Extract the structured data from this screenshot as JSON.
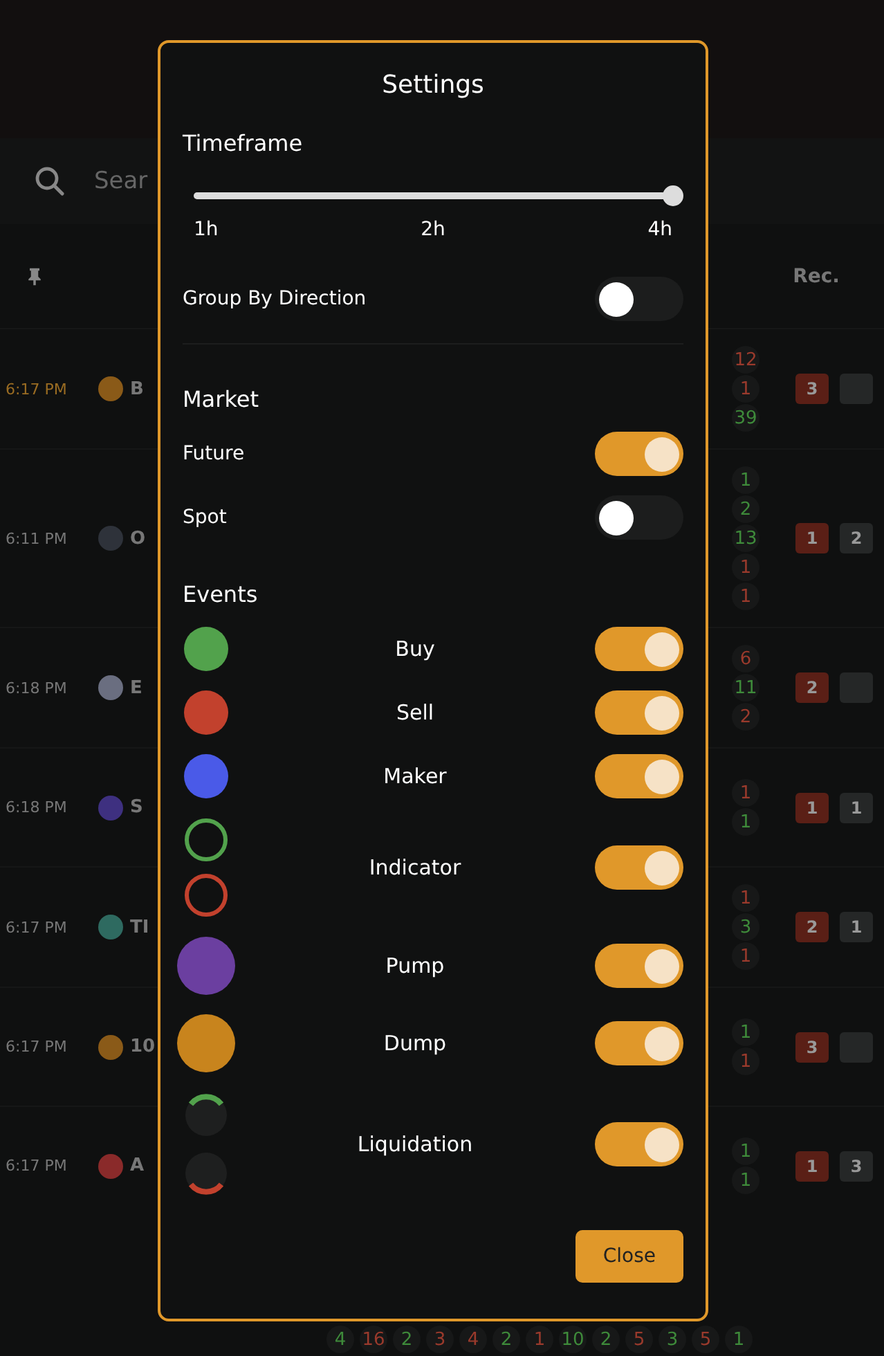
{
  "background": {
    "search": {
      "placeholder": "Sear"
    },
    "rec_header": "Rec.",
    "rows": [
      {
        "time": "6:17 PM",
        "ticker": "B",
        "highlighted": true,
        "color": "#8a5a18",
        "counts": [
          {
            "value": "12",
            "color": "#9a3a2c"
          },
          {
            "value": "1",
            "color": "#9a3a2c"
          },
          {
            "value": "39",
            "color": "#3e8a3a"
          }
        ],
        "rec_sell": "3"
      },
      {
        "time": "6:11 PM",
        "ticker": "O",
        "highlighted": false,
        "color": "#2e323a",
        "counts": [
          {
            "value": "1",
            "color": "#3e8a3a"
          },
          {
            "value": "2",
            "color": "#3e8a3a"
          },
          {
            "value": "13",
            "color": "#3e8a3a"
          },
          {
            "value": "1",
            "color": "#9a3a2c"
          },
          {
            "value": "1",
            "color": "#9a3a2c"
          }
        ],
        "rec_sell": "1",
        "rec_buy": "2"
      },
      {
        "time": "6:18 PM",
        "ticker": "E",
        "highlighted": false,
        "color": "#6a6e80",
        "counts": [
          {
            "value": "6",
            "color": "#9a3a2c"
          },
          {
            "value": "11",
            "color": "#3e8a3a"
          },
          {
            "value": "2",
            "color": "#9a3a2c"
          }
        ],
        "rec_sell": "2"
      },
      {
        "time": "6:18 PM",
        "ticker": "S",
        "highlighted": false,
        "color": "#3e3080",
        "counts": [
          {
            "value": "1",
            "color": "#9a3a2c"
          },
          {
            "value": "1",
            "color": "#3e8a3a"
          }
        ],
        "rec_sell": "1",
        "rec_buy": "1"
      },
      {
        "time": "6:17 PM",
        "ticker": "TI",
        "highlighted": false,
        "color": "#2e6a60",
        "counts": [
          {
            "value": "1",
            "color": "#9a3a2c"
          },
          {
            "value": "3",
            "color": "#3e8a3a"
          },
          {
            "value": "1",
            "color": "#9a3a2c"
          }
        ],
        "rec_sell": "2",
        "rec_buy": "1"
      },
      {
        "time": "6:17 PM",
        "ticker": "10",
        "highlighted": false,
        "color": "#8a5a18",
        "counts": [
          {
            "value": "1",
            "color": "#3e8a3a"
          },
          {
            "value": "1",
            "color": "#9a3a2c"
          }
        ],
        "rec_sell": "3"
      },
      {
        "time": "6:17 PM",
        "ticker": "A",
        "highlighted": false,
        "color": "#8a2a2a",
        "counts": [
          {
            "value": "1",
            "color": "#3e8a3a"
          },
          {
            "value": "1",
            "color": "#3e8a3a"
          }
        ],
        "rec_sell": "1",
        "rec_buy": "3"
      }
    ],
    "bottom_counts": [
      {
        "value": "4",
        "color": "#3e8a3a"
      },
      {
        "value": "16",
        "color": "#9a3a2c"
      },
      {
        "value": "2",
        "color": "#3e8a3a"
      },
      {
        "value": "3",
        "color": "#9a3a2c"
      },
      {
        "value": "4",
        "color": "#9a3a2c"
      },
      {
        "value": "2",
        "color": "#3e8a3a"
      },
      {
        "value": "1",
        "color": "#9a3a2c"
      },
      {
        "value": "10",
        "color": "#3e8a3a"
      },
      {
        "value": "2",
        "color": "#3e8a3a"
      },
      {
        "value": "5",
        "color": "#9a3a2c"
      },
      {
        "value": "3",
        "color": "#3e8a3a"
      },
      {
        "value": "5",
        "color": "#9a3a2c"
      },
      {
        "value": "1",
        "color": "#3e8a3a"
      }
    ]
  },
  "settings": {
    "title": "Settings",
    "timeframe": {
      "heading": "Timeframe",
      "level": 1,
      "labels": [
        "1h",
        "2h",
        "4h"
      ]
    },
    "group_by_direction": {
      "label": "Group By Direction",
      "on": false
    },
    "market": {
      "heading": "Market",
      "options": [
        {
          "label": "Future",
          "on": true
        },
        {
          "label": "Spot",
          "on": false
        }
      ]
    },
    "events": {
      "heading": "Events",
      "items": [
        {
          "label": "Buy",
          "on": true,
          "kind": "dot",
          "icons": [
            {
              "color": "#52a24c"
            }
          ]
        },
        {
          "label": "Sell",
          "on": true,
          "kind": "dot",
          "icons": [
            {
              "color": "#c2412d"
            }
          ]
        },
        {
          "label": "Maker",
          "on": true,
          "kind": "dot",
          "icons": [
            {
              "color": "#4a5ae8"
            }
          ]
        },
        {
          "label": "Indicator",
          "on": true,
          "kind": "rings",
          "icons": [
            {
              "color": "#52a24c"
            },
            {
              "color": "#c2412d"
            }
          ]
        },
        {
          "label": "Pump",
          "on": true,
          "kind": "big-dot",
          "icons": [
            {
              "color": "#6b3fa0"
            }
          ]
        },
        {
          "label": "Dump",
          "on": true,
          "kind": "big-dot",
          "icons": [
            {
              "color": "#c8841d"
            }
          ]
        },
        {
          "label": "Liquidation",
          "on": true,
          "kind": "arcs",
          "icons": [
            {
              "color": "#52a24c"
            },
            {
              "color": "#c2412d"
            }
          ]
        }
      ]
    },
    "close_button": "Close"
  }
}
